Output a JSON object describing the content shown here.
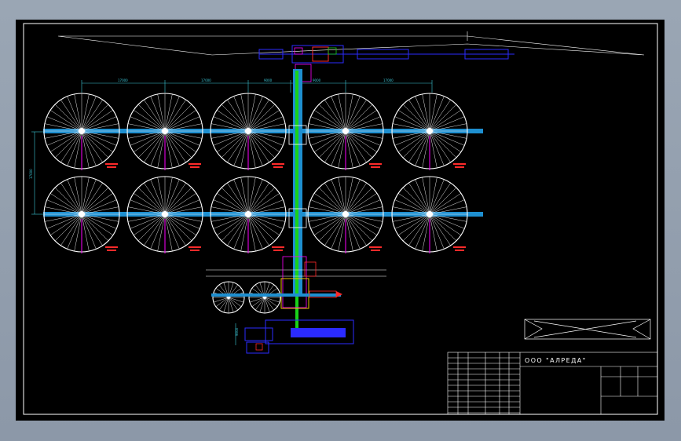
{
  "drawing": {
    "company": "ООО \"АЛРЕДА\"",
    "dimensions": {
      "spacing_1": "17000",
      "spacing_2": "17000",
      "spacing_3": "9000",
      "spacing_4": "9000",
      "spacing_5": "17000",
      "vertical": "17000",
      "lower": "9000"
    }
  },
  "colors": {
    "background": "#000000",
    "frame": "#ffffff",
    "pipe_main": "#1e8fd0",
    "pipe_green": "#19d219",
    "marker_magenta": "#ff00ff",
    "label_red": "#ff2a2a",
    "equipment_blue": "#2b2bff",
    "dimension_cyan": "#3cc8d8"
  },
  "icons": {
    "tank": "spoked-circle-tank",
    "compass_marker": "red-arrow-marker"
  }
}
